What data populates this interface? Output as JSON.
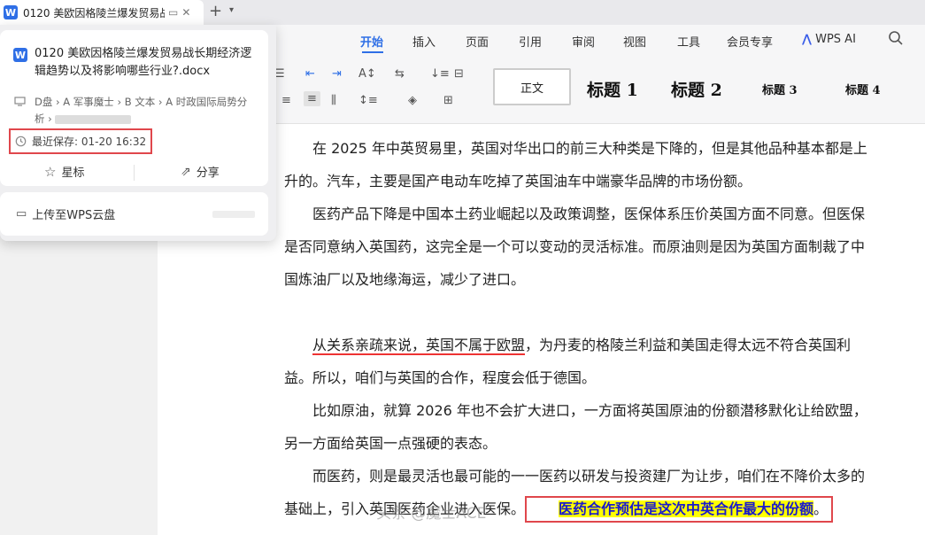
{
  "tab": {
    "title": "0120 美欧因格陵兰爆发贸易战长期经济逻辑趋势以及将影响哪些行业?.docx",
    "short_title": "0120 美欧因格陵兰爆发贸易战"
  },
  "menu": {
    "items": [
      "开始",
      "插入",
      "页面",
      "引用",
      "审阅",
      "视图",
      "工具",
      "会员专享",
      "WPS AI"
    ]
  },
  "styles": {
    "normal": "正文",
    "h1": "标题 1",
    "h2": "标题 2",
    "h3": "标题 3",
    "h4": "标题 4"
  },
  "popup": {
    "file_name": "0120 美欧因格陵兰爆发贸易战长期经济逻辑趋势以及将影响哪些行业?.docx",
    "path_parts": [
      "D盘",
      "A 军事魔士",
      "B 文本",
      "A 时政国际局势分析"
    ],
    "last_saved": "最近保存: 01-20 16:32",
    "star_label": "星标",
    "share_label": "分享",
    "upload_label": "上传至WPS云盘"
  },
  "doc": {
    "p1": "在 2025 年中英贸易里，英国对华出口的前三大种类是下降的，但是其他品种基本都是上升的。汽车，主要是国产电动车吃掉了英国油车中端豪华品牌的市场份额。",
    "p2": "医药产品下降是中国本土药业崛起以及政策调整，医保体系压价英国方面不同意。但医保是否同意纳入英国药，这完全是一个可以变动的灵活标准。而原油则是因为英国方面制裁了中国炼油厂以及地缘海运，减少了进口。",
    "p3a": "从关系亲疏来说，英国不属于欧盟",
    "p3b": "，为丹麦的格陵兰利益和美国走得太远不符合英国利益。所以，咱们与英国的合作，程度会低于德国。",
    "p4": "比如原油，就算 2026 年也不会扩大进口，一方面将英国原油的份额潜移默化让给欧盟，另一方面给英国一点强硬的表态。",
    "p5": "而医药，则是最灵活也最可能的一一医药以研发与投资建厂为让步，咱们在不降价太多的基础上，引入英国医药企业进入医保。",
    "highlight": "医药合作预估是这次中英合作最大的份额",
    "end_mark": "。",
    "watermark": "头条 @魔士ACE"
  }
}
